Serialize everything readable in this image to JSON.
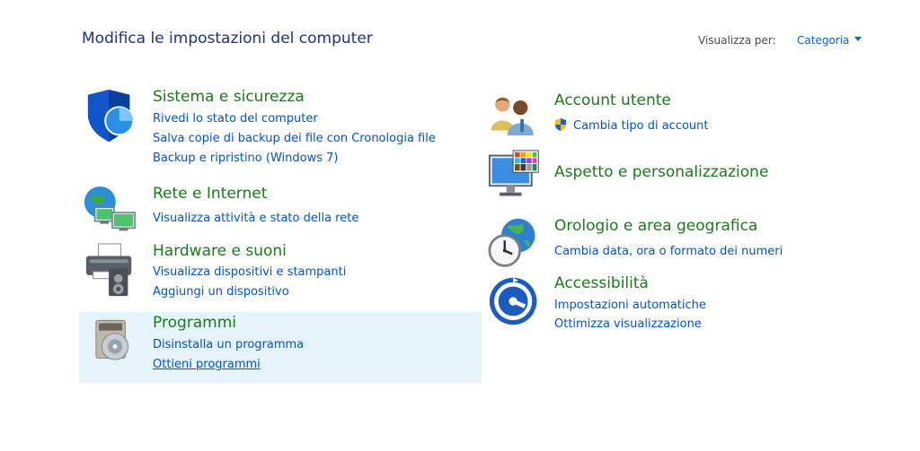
{
  "header": {
    "title": "Modifica le impostazioni del computer",
    "view_by_label": "Visualizza per:",
    "view_by_value": "Categoria"
  },
  "left_categories": [
    {
      "title": "Sistema e sicurezza",
      "icon": "shield-icon",
      "links": [
        "Rivedi lo stato del computer",
        "Salva copie di backup dei file con Cronologia file",
        "Backup e ripristino (Windows 7)"
      ]
    },
    {
      "title": "Rete e Internet",
      "icon": "network-globe-icon",
      "links": [
        "Visualizza attività e stato della rete"
      ]
    },
    {
      "title": "Hardware e suoni",
      "icon": "printer-speaker-icon",
      "links": [
        "Visualizza dispositivi e stampanti",
        "Aggiungi un dispositivo"
      ]
    },
    {
      "title": "Programmi",
      "icon": "programs-disc-icon",
      "links": [
        "Disinstalla un programma",
        "Ottieni programmi"
      ]
    }
  ],
  "right_categories": [
    {
      "title": "Account utente",
      "icon": "users-icon",
      "links": [
        "Cambia tipo di account"
      ]
    },
    {
      "title": "Aspetto e personalizzazione",
      "icon": "monitor-palette-icon",
      "links": []
    },
    {
      "title": "Orologio e area geografica",
      "icon": "clock-globe-icon",
      "links": [
        "Cambia data, ora o formato dei numeri"
      ]
    },
    {
      "title": "Accessibilità",
      "icon": "accessibility-icon",
      "links": [
        "Impostazioni automatiche",
        "Ottimizza visualizzazione"
      ]
    }
  ],
  "colors": {
    "title_blue": "#1e3287",
    "category_green": "#1c7a1c",
    "link_blue": "#0055cc",
    "hover_bg": "#e5f3fb"
  }
}
